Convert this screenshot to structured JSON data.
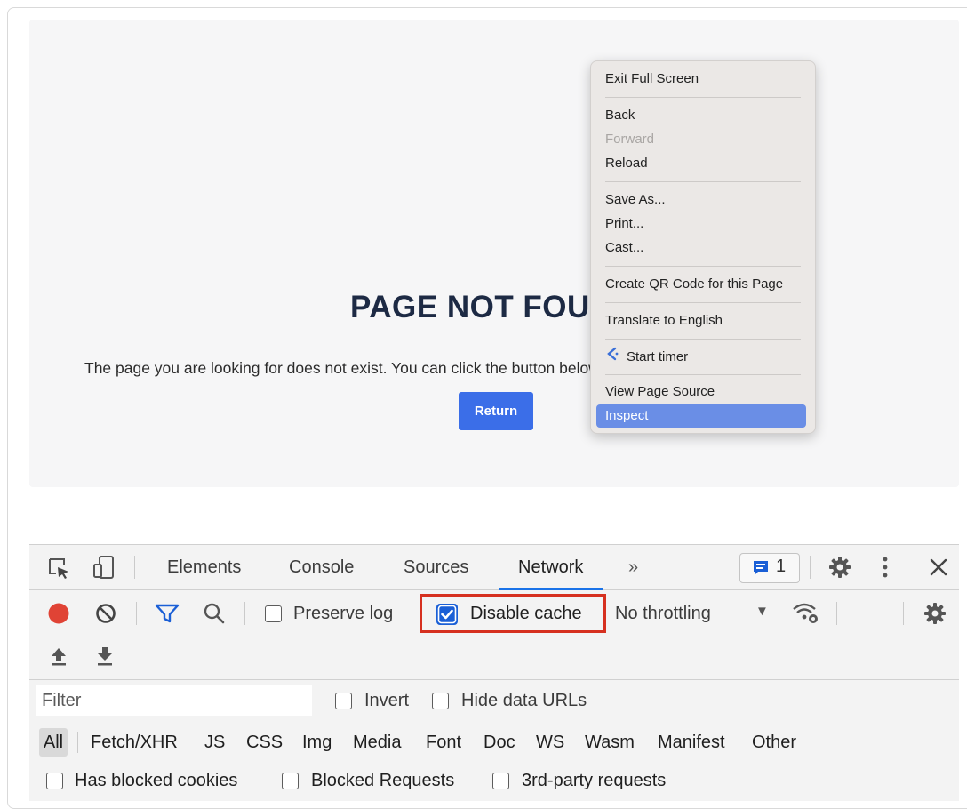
{
  "page": {
    "title": "PAGE NOT FOUND",
    "message": "The page you are looking for does not exist. You can click the button below to go back to the homepage.",
    "return_label": "Return"
  },
  "context_menu": {
    "items": [
      {
        "label": "Exit Full Screen",
        "enabled": true
      },
      {
        "label": "Back",
        "enabled": true
      },
      {
        "label": "Forward",
        "enabled": false
      },
      {
        "label": "Reload",
        "enabled": true
      },
      {
        "label": "Save As...",
        "enabled": true
      },
      {
        "label": "Print...",
        "enabled": true
      },
      {
        "label": "Cast...",
        "enabled": true
      },
      {
        "label": "Create QR Code for this Page",
        "enabled": true
      },
      {
        "label": "Translate to English",
        "enabled": true
      },
      {
        "label": "Start timer",
        "enabled": true,
        "icon": "timer-icon"
      },
      {
        "label": "View Page Source",
        "enabled": true
      },
      {
        "label": "Inspect",
        "enabled": true,
        "highlighted": true
      }
    ]
  },
  "devtools": {
    "tabs": [
      "Elements",
      "Console",
      "Sources",
      "Network"
    ],
    "active_tab": "Network",
    "more_tabs": "»",
    "messages_count": "1",
    "toolbar": {
      "preserve_log": "Preserve log",
      "preserve_log_checked": false,
      "disable_cache": "Disable cache",
      "disable_cache_checked": true,
      "throttling": "No throttling",
      "throttling_arrow": "▼"
    },
    "filter": {
      "placeholder": "Filter",
      "invert": "Invert",
      "hide_data_urls": "Hide data URLs"
    },
    "types": [
      "All",
      "Fetch/XHR",
      "JS",
      "CSS",
      "Img",
      "Media",
      "Font",
      "Doc",
      "WS",
      "Wasm",
      "Manifest",
      "Other"
    ],
    "bottom_checkboxes": [
      "Has blocked cookies",
      "Blocked Requests",
      "3rd-party requests"
    ]
  },
  "colors": {
    "accent": "#1a73e8",
    "return_button": "#3b6ee8",
    "highlight_box": "#d6301f",
    "record": "#e04335"
  }
}
